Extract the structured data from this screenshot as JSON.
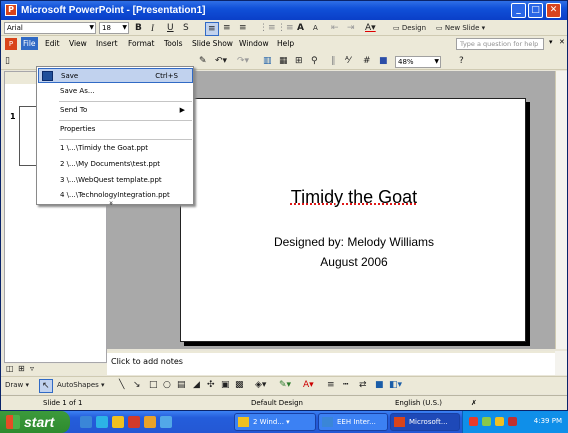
{
  "window": {
    "title": "Microsoft PowerPoint - [Presentation1]",
    "minimize": "_",
    "maximize": "□",
    "close": "✕"
  },
  "format_bar": {
    "font": "Arial",
    "size": "18",
    "bold": "B",
    "italic": "I",
    "underline": "U",
    "shadow": "S",
    "grow_font": "A",
    "shrink_font": "A",
    "design": "Design",
    "new_slide": "New Slide"
  },
  "menu": {
    "items": [
      "File",
      "Edit",
      "View",
      "Insert",
      "Format",
      "Tools",
      "Slide Show",
      "Window",
      "Help"
    ],
    "help_placeholder": "Type a question for help"
  },
  "standard_bar": {
    "zoom": "48%"
  },
  "file_menu": {
    "items": [
      {
        "label": "Save",
        "shortcut": "Ctrl+S"
      },
      {
        "label": "Save As..."
      },
      {
        "label": "Send To"
      },
      {
        "label": "Properties"
      },
      {
        "label": "1 \\...\\Timidy the Goat.ppt"
      },
      {
        "label": "2 \\...\\My Documents\\test.ppt"
      },
      {
        "label": "3 \\...\\WebQuest template.ppt"
      },
      {
        "label": "4 \\...\\TechnologyIntegration.ppt"
      }
    ],
    "more": "»"
  },
  "left_pane": {
    "slide_number": "1"
  },
  "slide": {
    "title": "Timidy the Goat",
    "subtitle_line1": "Designed by: Melody Williams",
    "subtitle_line2": "August 2006"
  },
  "notes": {
    "placeholder": "Click to add notes"
  },
  "draw_bar": {
    "draw": "Draw",
    "autoshapes": "AutoShapes"
  },
  "status_bar": {
    "slide": "Slide 1 of 1",
    "design": "Default Design",
    "language": "English (U.S.)"
  },
  "taskbar": {
    "start": "start",
    "tasks": [
      {
        "label": "2 Wind...",
        "active": false
      },
      {
        "label": "EEH Inter...",
        "active": false
      },
      {
        "label": "Microsoft...",
        "active": true
      }
    ],
    "clock": "4:39 PM"
  }
}
